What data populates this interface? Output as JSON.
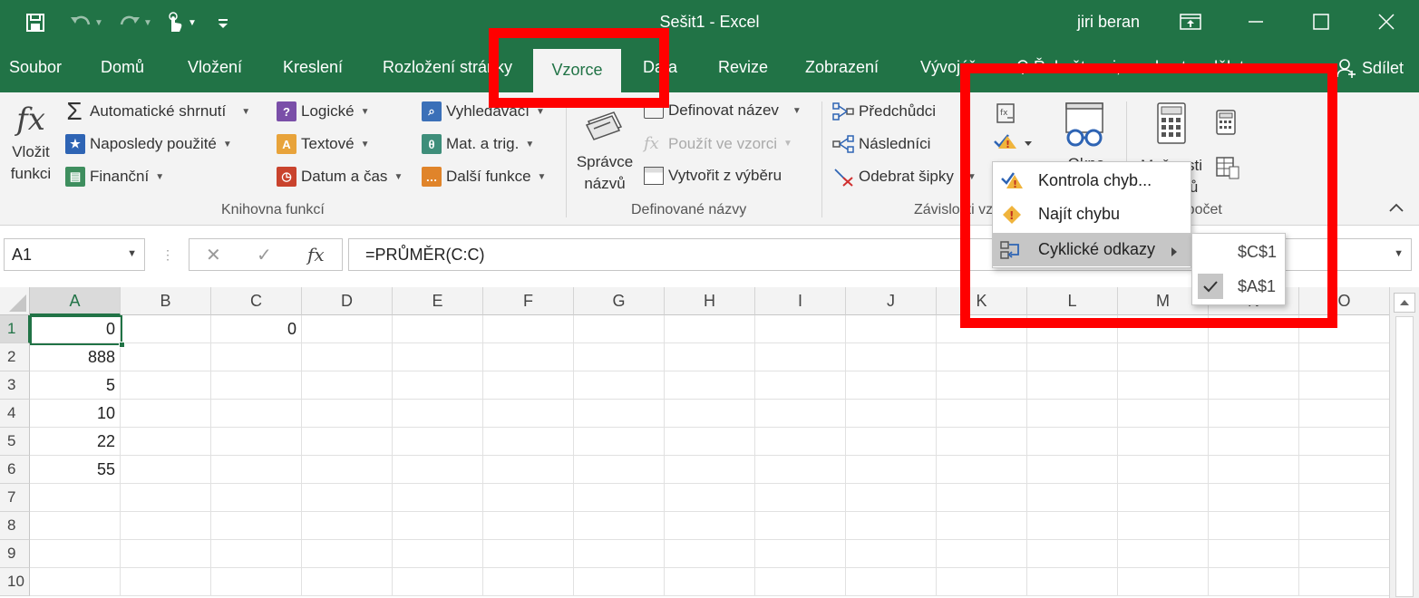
{
  "window": {
    "title": "Sešit1 - Excel",
    "user": "jiri beran",
    "qat_icons": [
      "save-icon",
      "undo-icon",
      "redo-icon",
      "touch-mode-icon",
      "customize-qat-icon"
    ],
    "window_icons": [
      "ribbon-display-options-icon",
      "minimize-icon",
      "maximize-icon",
      "close-icon"
    ]
  },
  "tabs": [
    {
      "label": "Soubor"
    },
    {
      "label": "Domů"
    },
    {
      "label": "Vložení"
    },
    {
      "label": "Kreslení"
    },
    {
      "label": "Rozložení stránky"
    },
    {
      "label": "Vzorce",
      "active": true
    },
    {
      "label": "Data"
    },
    {
      "label": "Revize"
    },
    {
      "label": "Zobrazení"
    },
    {
      "label": "Vývojář"
    }
  ],
  "tell_me": "Řekněte mi, co chcete udělat",
  "share": "Sdílet",
  "ribbon": {
    "insert_function": {
      "line1": "Vložit",
      "line2": "funkci"
    },
    "library": [
      {
        "label": "Automatické shrnutí",
        "icon": "sum-icon"
      },
      {
        "label": "Naposledy použité",
        "icon": "star-book-icon"
      },
      {
        "label": "Finanční",
        "icon": "financial-book-icon"
      },
      {
        "label": "Logické",
        "icon": "logical-book-icon"
      },
      {
        "label": "Textové",
        "icon": "text-book-icon"
      },
      {
        "label": "Datum a čas",
        "icon": "clock-book-icon"
      },
      {
        "label": "Vyhledávací",
        "icon": "lookup-book-icon"
      },
      {
        "label": "Mat. a trig.",
        "icon": "math-book-icon"
      },
      {
        "label": "Další funkce",
        "icon": "more-functions-book-icon"
      }
    ],
    "library_group": "Knihovna funkcí",
    "name_manager": {
      "line1": "Správce",
      "line2": "názvů"
    },
    "defined_names": [
      {
        "label": "Definovat název"
      },
      {
        "label": "Použít ve vzorci",
        "disabled": true
      },
      {
        "label": "Vytvořit z výběru"
      }
    ],
    "defined_group": "Definované názvy",
    "auditing": [
      {
        "label": "Předchůdci"
      },
      {
        "label": "Následníci"
      },
      {
        "label": "Odebrat šipky"
      }
    ],
    "auditing_group": "Závislosti vzorců",
    "watch_window": "Okno",
    "calc_options": {
      "line1": "Možnosti",
      "line2": "výpočtů"
    },
    "calc_group": "Výpočet",
    "colors": {
      "excel_green": "#217346",
      "ribbon_bg": "#f3f3f3",
      "annotation_red": "#ff0000"
    }
  },
  "formula_bar": {
    "name_box": "A1",
    "cancel": "✕",
    "enter": "✓",
    "fx": "fx",
    "formula": "=PRŮMĚR(C:C)"
  },
  "grid": {
    "columns": [
      "A",
      "B",
      "C",
      "D",
      "E",
      "F",
      "G",
      "H",
      "I",
      "J",
      "K",
      "L",
      "M",
      "N",
      "O"
    ],
    "rows": [
      "1",
      "2",
      "3",
      "4",
      "5",
      "6",
      "7",
      "8",
      "9",
      "10"
    ],
    "cells": {
      "A1": "0",
      "C1": "0",
      "A2": "888",
      "A3": "5",
      "A4": "10",
      "A5": "22",
      "A6": "55"
    }
  },
  "error_menu": {
    "items": [
      {
        "label": "Kontrola chyb...",
        "icon": "error-checking-icon"
      },
      {
        "label": "Najít chybu",
        "icon": "trace-error-icon"
      },
      {
        "label": "Cyklické odkazy",
        "icon": "circular-references-icon",
        "has_submenu": true
      }
    ],
    "submenu": [
      {
        "label": "$C$1",
        "checked": false
      },
      {
        "label": "$A$1",
        "checked": true
      }
    ]
  }
}
